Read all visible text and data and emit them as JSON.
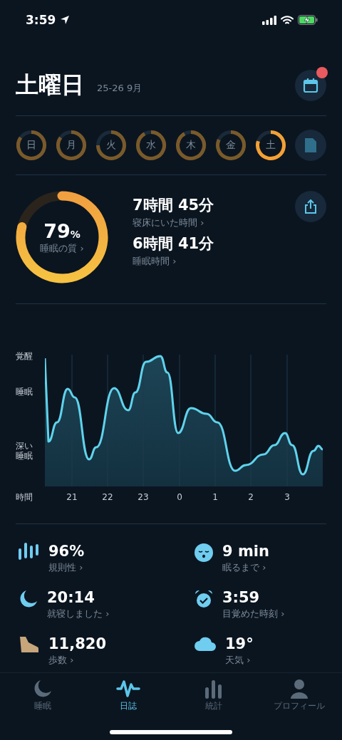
{
  "status_bar": {
    "time": "3:59"
  },
  "header": {
    "title": "土曜日",
    "date": "25-26 9月",
    "notification": true
  },
  "days": [
    {
      "label": "日",
      "selected": false
    },
    {
      "label": "月",
      "selected": false
    },
    {
      "label": "火",
      "selected": false
    },
    {
      "label": "水",
      "selected": false
    },
    {
      "label": "木",
      "selected": false
    },
    {
      "label": "金",
      "selected": false
    },
    {
      "label": "土",
      "selected": true
    }
  ],
  "summary": {
    "quality": {
      "value": "79",
      "unit": "%",
      "label": "睡眠の質 ›"
    },
    "metrics": [
      {
        "value": "7時間 45分",
        "label": "寝床にいた時間 ›"
      },
      {
        "value": "6時間 41分",
        "label": "睡眠時間 ›"
      }
    ]
  },
  "chart": {
    "y_labels": [
      "覚醒",
      "睡眠",
      "深い睡眠"
    ],
    "x_title": "時間",
    "x_labels": [
      "21",
      "22",
      "23",
      "0",
      "1",
      "2",
      "3"
    ]
  },
  "stats": [
    {
      "kind": "bars",
      "value": "96%",
      "label": "規則性 ›"
    },
    {
      "kind": "face",
      "value": "9 min",
      "label": "眠るまで ›"
    },
    {
      "kind": "moon",
      "value": "20:14",
      "label": "就寝しました ›"
    },
    {
      "kind": "alarm",
      "value": "3:59",
      "label": "目覚めた時刻 ›"
    },
    {
      "kind": "shoe",
      "value": "11,820",
      "label": "歩数 ›"
    },
    {
      "kind": "cloud",
      "value": "19°",
      "label": "天気 ›"
    }
  ],
  "tabs": [
    {
      "label": "睡眠",
      "selected": false
    },
    {
      "label": "日誌",
      "selected": true
    },
    {
      "label": "統計",
      "selected": false
    },
    {
      "label": "プロフィール",
      "selected": false
    }
  ]
}
